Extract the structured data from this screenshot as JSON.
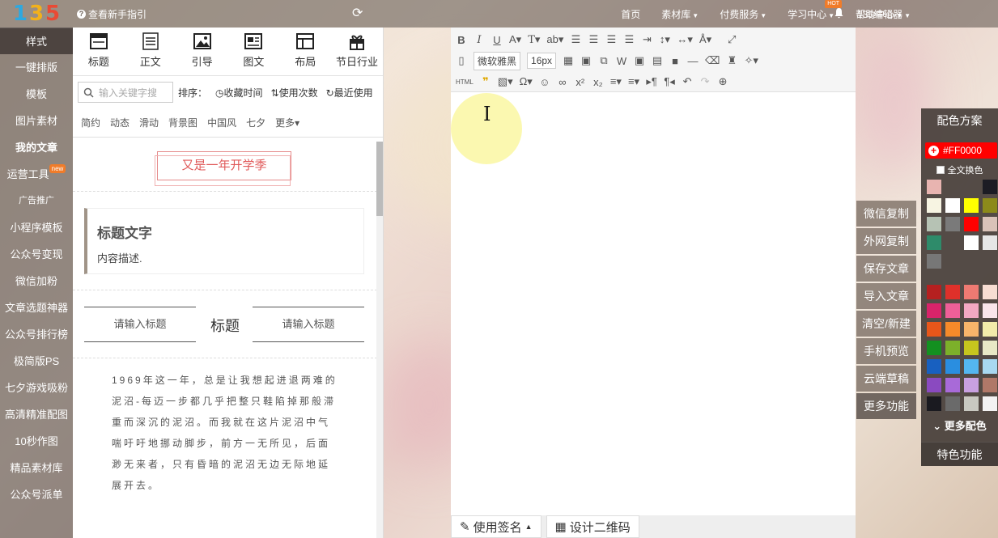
{
  "topbar": {
    "logo_chars": [
      "1",
      "3",
      "5"
    ],
    "guide": "查看新手指引",
    "nav": [
      {
        "label": "首页",
        "caret": false
      },
      {
        "label": "素材库",
        "caret": true
      },
      {
        "label": "付费服务",
        "caret": true
      },
      {
        "label": "学习中心",
        "caret": true,
        "badge": "HOT"
      },
      {
        "label": "帮助中心",
        "caret": true
      }
    ],
    "user": "135编辑器"
  },
  "leftnav": [
    "样式",
    "一键排版",
    "模板",
    "图片素材",
    "我的文章",
    "运营工具",
    "广告推广",
    "小程序模板",
    "公众号变现",
    "微信加粉",
    "文章选题神器",
    "公众号排行榜",
    "极简版PS",
    "七夕游戏吸粉",
    "高清精准配图",
    "10秒作图",
    "精品素材库",
    "公众号派单"
  ],
  "leftnav_badge": "new",
  "panel": {
    "categories": [
      "标题",
      "正文",
      "引导",
      "图文",
      "布局",
      "节日行业"
    ],
    "search_placeholder": "输入关键字搜",
    "sort_label": "排序：",
    "sort_options": [
      "收藏时间",
      "使用次数",
      "最近使用"
    ],
    "tags": [
      "简约",
      "动态",
      "滑动",
      "背景图",
      "中国风",
      "七夕",
      "更多▾"
    ],
    "samples": {
      "box_title": "又是一年开学季",
      "card_title": "标题文字",
      "card_desc": "内容描述.",
      "split_left": "请输入标题",
      "split_mid": "标题",
      "split_right": "请输入标题",
      "paragraph": "1969年这一年，总是让我想起进退两难的泥沼-每迈一步都几乎把整只鞋陷掉那般滞重而深沉的泥沼。而我就在这片泥沼中气喘吁吁地挪动脚步，前方一无所见，后面渺无来者，只有昏暗的泥沼无边无际地延展开去。"
    }
  },
  "editor": {
    "font": "微软雅黑",
    "size": "16px",
    "html_label": "HTML",
    "bottom": [
      "使用签名",
      "设计二维码"
    ]
  },
  "actions": [
    "微信复制",
    "外网复制",
    "保存文章",
    "导入文章",
    "清空/新建",
    "手机预览",
    "云端草稿",
    "更多功能"
  ],
  "color_panel": {
    "title": "配色方案",
    "current": "#FF0000",
    "all_label": "全文换色",
    "more": "更多配色",
    "special": "特色功能",
    "swatches_top": [
      "#e8b4b0",
      null,
      null,
      "#1c1c24",
      "#f7f4e2",
      "#ffffff",
      "#ffff00",
      "#8c8a1a",
      "#b6c2b4",
      "#7a7a7a",
      "#ff0000",
      "#d9c2b8",
      "#2e8b6a",
      null,
      "#ffffff",
      "#e6e6e6",
      "#777777",
      null,
      null,
      null
    ],
    "swatches_bottom": [
      "#b52020",
      "#e0302a",
      "#ee7a72",
      "#f7ddd2",
      "#d8236a",
      "#ee5f98",
      "#f2a8c2",
      "#f9e5ea",
      "#e8561a",
      "#f58a2a",
      "#f8b46a",
      "#f2ecaa",
      "#139020",
      "#7cb02a",
      "#c6c61e",
      "#e8e8c6",
      "#1860c0",
      "#2a8ee0",
      "#54b6f0",
      "#a8d8f0",
      "#8a4ac0",
      "#a86ad8",
      "#c8a0e0",
      "#b07868",
      "#1a1a20",
      "#6a6a6a",
      "#c8c8c0",
      "#f2f2f2"
    ]
  }
}
